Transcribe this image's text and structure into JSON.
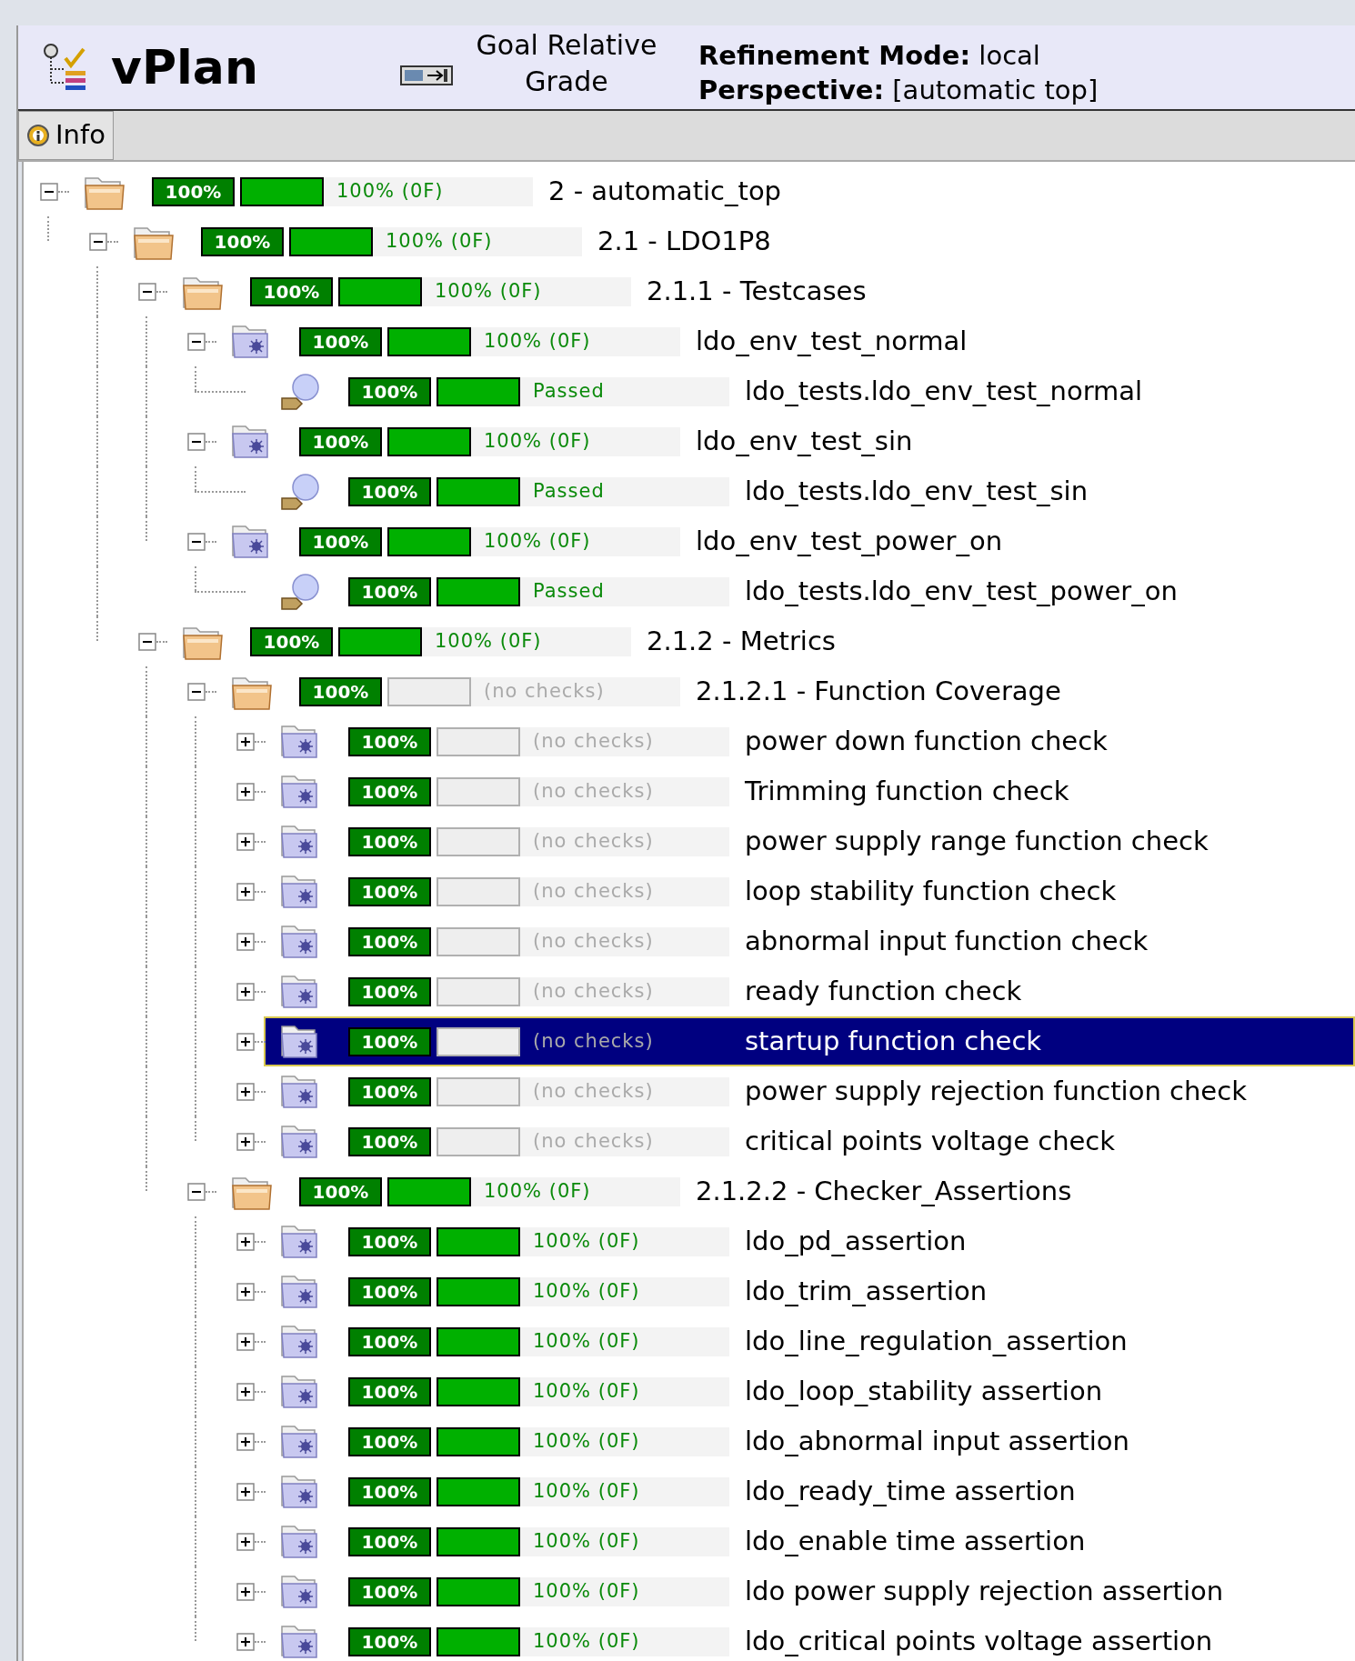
{
  "header": {
    "title": "vPlan",
    "goal_label": "Goal Relative Grade",
    "properties": [
      {
        "label": "Refinement Mode:",
        "value": "local"
      },
      {
        "label": "Perspective:",
        "value": "[automatic top]"
      }
    ]
  },
  "tabs": [
    {
      "label": "Info",
      "selected": true
    }
  ],
  "tree": [
    {
      "kind": "folder",
      "grade": "100%",
      "level": 1,
      "status": "100% (0F)",
      "label": "2 - automatic_top",
      "expanded": true,
      "selected": false,
      "children": [
        {
          "kind": "folder",
          "grade": "100%",
          "level": 1,
          "status": "100% (0F)",
          "label": "2.1 - LDO1P8",
          "expanded": true,
          "selected": false,
          "children": [
            {
              "kind": "folder",
              "grade": "100%",
              "level": 1,
              "status": "100% (0F)",
              "label": "2.1.1 - Testcases",
              "expanded": true,
              "selected": false,
              "children": [
                {
                  "kind": "group",
                  "grade": "100%",
                  "level": 1,
                  "status": "100% (0F)",
                  "label": "ldo_env_test_normal",
                  "expanded": true,
                  "selected": false,
                  "children": [
                    {
                      "kind": "test",
                      "grade": "100%",
                      "level": 1,
                      "status": "Passed",
                      "label": "ldo_tests.ldo_env_test_normal",
                      "selected": false
                    }
                  ]
                },
                {
                  "kind": "group",
                  "grade": "100%",
                  "level": 1,
                  "status": "100% (0F)",
                  "label": "ldo_env_test_sin",
                  "expanded": true,
                  "selected": false,
                  "children": [
                    {
                      "kind": "test",
                      "grade": "100%",
                      "level": 1,
                      "status": "Passed",
                      "label": "ldo_tests.ldo_env_test_sin",
                      "selected": false
                    }
                  ]
                },
                {
                  "kind": "group",
                  "grade": "100%",
                  "level": 1,
                  "status": "100% (0F)",
                  "label": "ldo_env_test_power_on",
                  "expanded": true,
                  "selected": false,
                  "children": [
                    {
                      "kind": "test",
                      "grade": "100%",
                      "level": 1,
                      "status": "Passed",
                      "label": "ldo_tests.ldo_env_test_power_on",
                      "selected": false
                    }
                  ]
                }
              ]
            },
            {
              "kind": "folder",
              "grade": "100%",
              "level": 1,
              "status": "100% (0F)",
              "label": "2.1.2 - Metrics",
              "expanded": true,
              "selected": false,
              "children": [
                {
                  "kind": "folder",
                  "grade": "100%",
                  "level": 0,
                  "status": "(no checks)",
                  "label": "2.1.2.1 - Function Coverage",
                  "expanded": true,
                  "selected": false,
                  "children": [
                    {
                      "kind": "group",
                      "grade": "100%",
                      "level": 0,
                      "status": "(no checks)",
                      "label": "power down function check",
                      "expanded": false,
                      "selected": false
                    },
                    {
                      "kind": "group",
                      "grade": "100%",
                      "level": 0,
                      "status": "(no checks)",
                      "label": "Trimming function check",
                      "expanded": false,
                      "selected": false
                    },
                    {
                      "kind": "group",
                      "grade": "100%",
                      "level": 0,
                      "status": "(no checks)",
                      "label": "power supply range function check",
                      "expanded": false,
                      "selected": false
                    },
                    {
                      "kind": "group",
                      "grade": "100%",
                      "level": 0,
                      "status": "(no checks)",
                      "label": "loop stability function check",
                      "expanded": false,
                      "selected": false
                    },
                    {
                      "kind": "group",
                      "grade": "100%",
                      "level": 0,
                      "status": "(no checks)",
                      "label": "abnormal input function check",
                      "expanded": false,
                      "selected": false
                    },
                    {
                      "kind": "group",
                      "grade": "100%",
                      "level": 0,
                      "status": "(no checks)",
                      "label": "ready function check",
                      "expanded": false,
                      "selected": false
                    },
                    {
                      "kind": "group",
                      "grade": "100%",
                      "level": 0,
                      "status": "(no checks)",
                      "label": "startup function check",
                      "expanded": false,
                      "selected": true
                    },
                    {
                      "kind": "group",
                      "grade": "100%",
                      "level": 0,
                      "status": "(no checks)",
                      "label": "power supply rejection function check",
                      "expanded": false,
                      "selected": false
                    },
                    {
                      "kind": "group",
                      "grade": "100%",
                      "level": 0,
                      "status": "(no checks)",
                      "label": "critical points voltage check",
                      "expanded": false,
                      "selected": false
                    }
                  ]
                },
                {
                  "kind": "folder",
                  "grade": "100%",
                  "level": 1,
                  "status": "100% (0F)",
                  "label": "2.1.2.2 - Checker_Assertions",
                  "expanded": true,
                  "selected": false,
                  "children": [
                    {
                      "kind": "group",
                      "grade": "100%",
                      "level": 1,
                      "status": "100% (0F)",
                      "label": "ldo_pd_assertion",
                      "expanded": false,
                      "selected": false
                    },
                    {
                      "kind": "group",
                      "grade": "100%",
                      "level": 1,
                      "status": "100% (0F)",
                      "label": "ldo_trim_assertion",
                      "expanded": false,
                      "selected": false
                    },
                    {
                      "kind": "group",
                      "grade": "100%",
                      "level": 1,
                      "status": "100% (0F)",
                      "label": "ldo_line_regulation_assertion",
                      "expanded": false,
                      "selected": false
                    },
                    {
                      "kind": "group",
                      "grade": "100%",
                      "level": 1,
                      "status": "100% (0F)",
                      "label": "ldo_loop_stability assertion",
                      "expanded": false,
                      "selected": false
                    },
                    {
                      "kind": "group",
                      "grade": "100%",
                      "level": 1,
                      "status": "100% (0F)",
                      "label": "ldo_abnormal input assertion",
                      "expanded": false,
                      "selected": false
                    },
                    {
                      "kind": "group",
                      "grade": "100%",
                      "level": 1,
                      "status": "100% (0F)",
                      "label": "ldo_ready_time assertion",
                      "expanded": false,
                      "selected": false
                    },
                    {
                      "kind": "group",
                      "grade": "100%",
                      "level": 1,
                      "status": "100% (0F)",
                      "label": "ldo_enable time assertion",
                      "expanded": false,
                      "selected": false
                    },
                    {
                      "kind": "group",
                      "grade": "100%",
                      "level": 1,
                      "status": "100% (0F)",
                      "label": "ldo power supply rejection assertion",
                      "expanded": false,
                      "selected": false
                    },
                    {
                      "kind": "group",
                      "grade": "100%",
                      "level": 1,
                      "status": "100% (0F)",
                      "label": "ldo_critical points voltage assertion",
                      "expanded": false,
                      "selected": false
                    }
                  ]
                }
              ]
            }
          ]
        }
      ]
    }
  ]
}
